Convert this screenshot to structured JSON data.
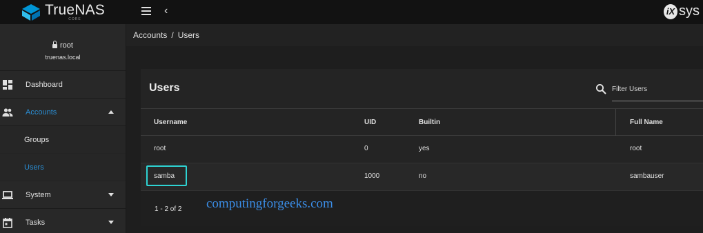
{
  "topbar": {
    "brand_name": "TrueNAS",
    "brand_sub": "CORE",
    "vendor_mark": "iX",
    "vendor_text": "sys"
  },
  "sidebar": {
    "user": "root",
    "host": "truenas.local",
    "items": [
      {
        "label": "Dashboard",
        "icon": "dashboard-icon"
      },
      {
        "label": "Accounts",
        "icon": "people-icon",
        "expanded": true,
        "active": true
      },
      {
        "label": "System",
        "icon": "laptop-icon",
        "expanded": false
      },
      {
        "label": "Tasks",
        "icon": "calendar-icon",
        "expanded": false
      }
    ],
    "sub_items": [
      {
        "label": "Groups",
        "active": false
      },
      {
        "label": "Users",
        "active": true
      }
    ],
    "accent_color": "#2a8fd6"
  },
  "breadcrumb": {
    "parent": "Accounts",
    "separator": "/",
    "current": "Users"
  },
  "card": {
    "title": "Users",
    "filter_placeholder": "Filter Users",
    "columns": [
      "Username",
      "UID",
      "Builtin",
      "Full Name"
    ],
    "rows": [
      {
        "username": "root",
        "uid": "0",
        "builtin": "yes",
        "full_name": "root"
      },
      {
        "username": "samba",
        "uid": "1000",
        "builtin": "no",
        "full_name": "sambauser"
      }
    ],
    "highlighted_row": "samba",
    "highlight_color": "#2ed4d4",
    "pager": "1 - 2 of 2"
  },
  "watermark": "computingforgeeks.com"
}
